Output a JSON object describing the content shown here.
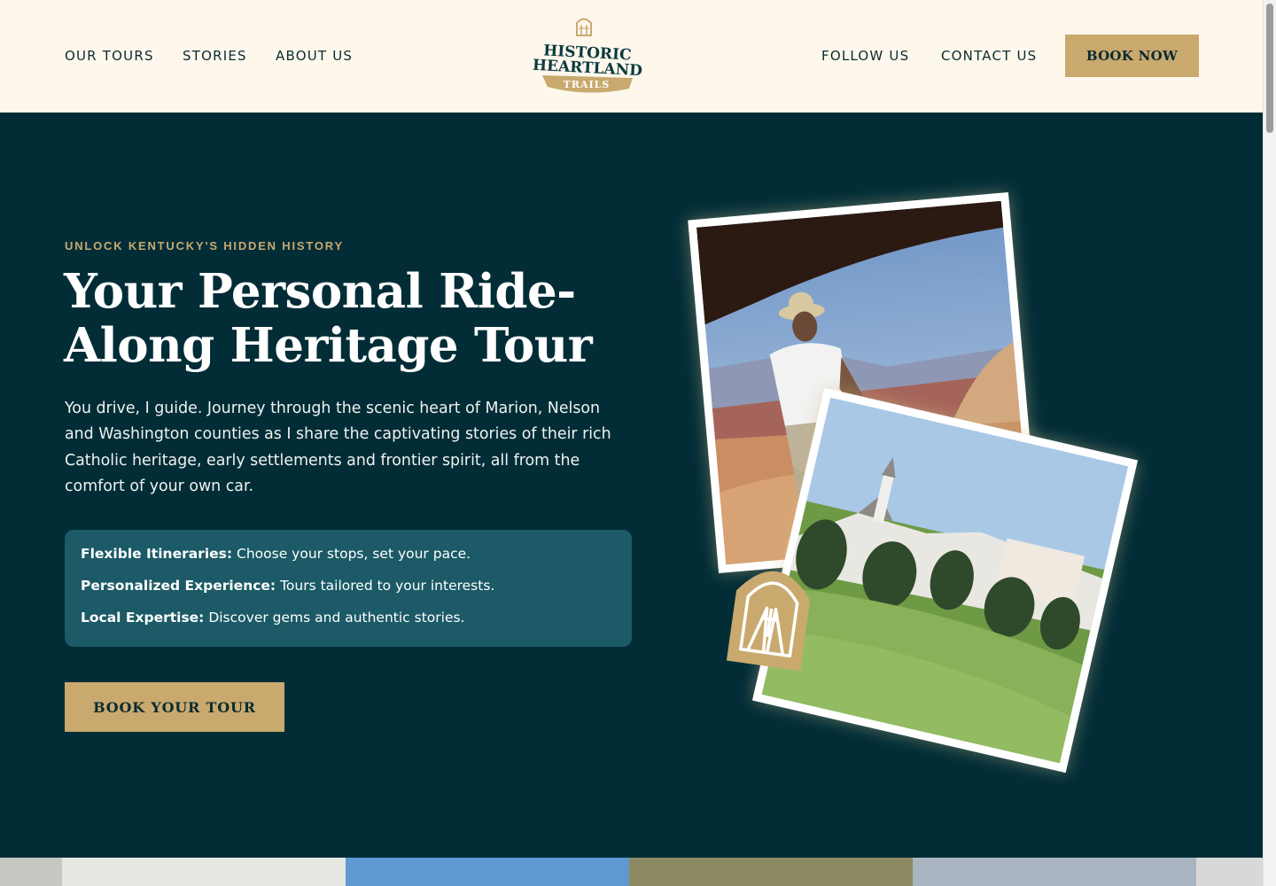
{
  "nav": {
    "left_links": [
      "OUR TOURS",
      "STORIES",
      "ABOUT US"
    ],
    "right_links": [
      "FOLLOW US",
      "CONTACT US"
    ],
    "cta": "BOOK NOW",
    "logo": {
      "line1": "HISTORIC",
      "line2": "HEARTLAND",
      "ribbon": "TRAILS",
      "icon": "chapel-window-icon"
    }
  },
  "hero": {
    "eyebrow": "UNLOCK KENTUCKY'S HIDDEN HISTORY",
    "headline_line1": "Your Personal Ride-",
    "headline_line2": "Along Heritage Tour",
    "lead": "You drive, I guide. Journey through the scenic heart of Marion, Nelson and Washington counties as I share the captivating stories of their rich Catholic heritage, early settlements and frontier spirit, all from the comfort of your own car.",
    "features": [
      {
        "title": "Flexible Itineraries:",
        "text": " Choose your stops, set your pace."
      },
      {
        "title": "Personalized Experience:",
        "text": " Tours tailored to your interests."
      },
      {
        "title": "Local Expertise:",
        "text": " Discover gems and authentic stories."
      }
    ],
    "cta": "BOOK YOUR TOUR"
  },
  "colors": {
    "cream": "#fdf7ec",
    "deep_teal": "#022d37",
    "panel_teal": "#1b5a66",
    "gold": "#c9a96e",
    "ink": "#0b2b30"
  }
}
